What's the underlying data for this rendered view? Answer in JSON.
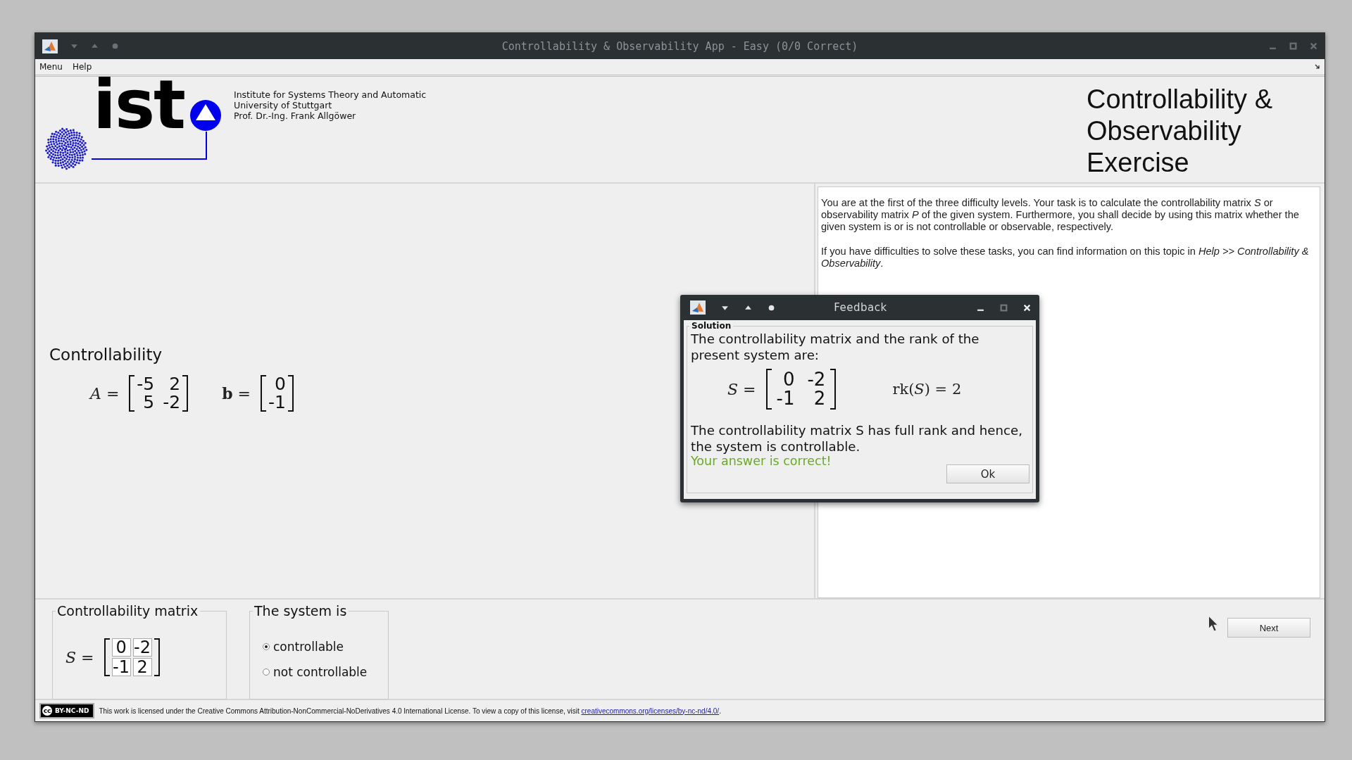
{
  "window": {
    "title": "Controllability & Observability App - Easy (0/0 Correct)"
  },
  "menu": [
    "Menu",
    "Help"
  ],
  "header": {
    "logo_text": "ist",
    "institute_lines": [
      "Institute for Systems Theory and Automatic",
      "University of Stuttgart",
      "Prof. Dr.-Ing. Frank Allgöwer"
    ],
    "title_lines": [
      "Controllability &",
      "Observability",
      "Exercise"
    ]
  },
  "instructions": [
    "You are at the first of the three difficulty levels. Your task is to calculate the controllability matrix *S*  or observability matrix *P*  of the given system. Furthermore, you shall decide by using this matrix whether the given system is or is not controllable or observable, respectively.",
    "If you have difficulties to solve these tasks, you can find information on this topic in *Help   >> Controllability & Observability*."
  ],
  "exercise": {
    "title": "Controllability",
    "matrices": [
      {
        "label": "*A* =",
        "rows": [
          [
            "-5",
            "2"
          ],
          [
            "5",
            "-2"
          ]
        ]
      },
      {
        "label": "**b** =",
        "rows": [
          [
            "0"
          ],
          [
            "-1"
          ]
        ]
      }
    ]
  },
  "answer": {
    "matrix_group": {
      "title": "Controllability matrix",
      "label": "*S* =",
      "rows": [
        [
          "0",
          "-2"
        ],
        [
          "-1",
          "2"
        ]
      ]
    },
    "system_group": {
      "title": "The system is",
      "options": [
        {
          "label": "controllable",
          "selected": true
        },
        {
          "label": "not controllable",
          "selected": false
        }
      ]
    }
  },
  "next_button": "Next",
  "dialog": {
    "title": "Feedback",
    "group_title": "Solution",
    "intro": "The controllability matrix and the rank of the present system are:",
    "matrix": {
      "label": "*S* =",
      "rows": [
        [
          "0",
          "-2"
        ],
        [
          "-1",
          "2"
        ]
      ]
    },
    "rank": "rk(*S*) = 2",
    "conclusion": "The controllability matrix S has full rank and hence, the system is controllable.",
    "result": "Your answer is correct!",
    "ok_button": "Ok"
  },
  "license": {
    "badge_cc": "cc",
    "badge_text": "BY-NC-ND",
    "text": "This work is licensed under the Creative Commons Attribution-NonCommercial-NoDerivatives 4.0 International License. To view a copy of this license, visit ",
    "link": "creativecommons.org/licenses/by-nc-nd/4.0/",
    "text_end": "."
  }
}
